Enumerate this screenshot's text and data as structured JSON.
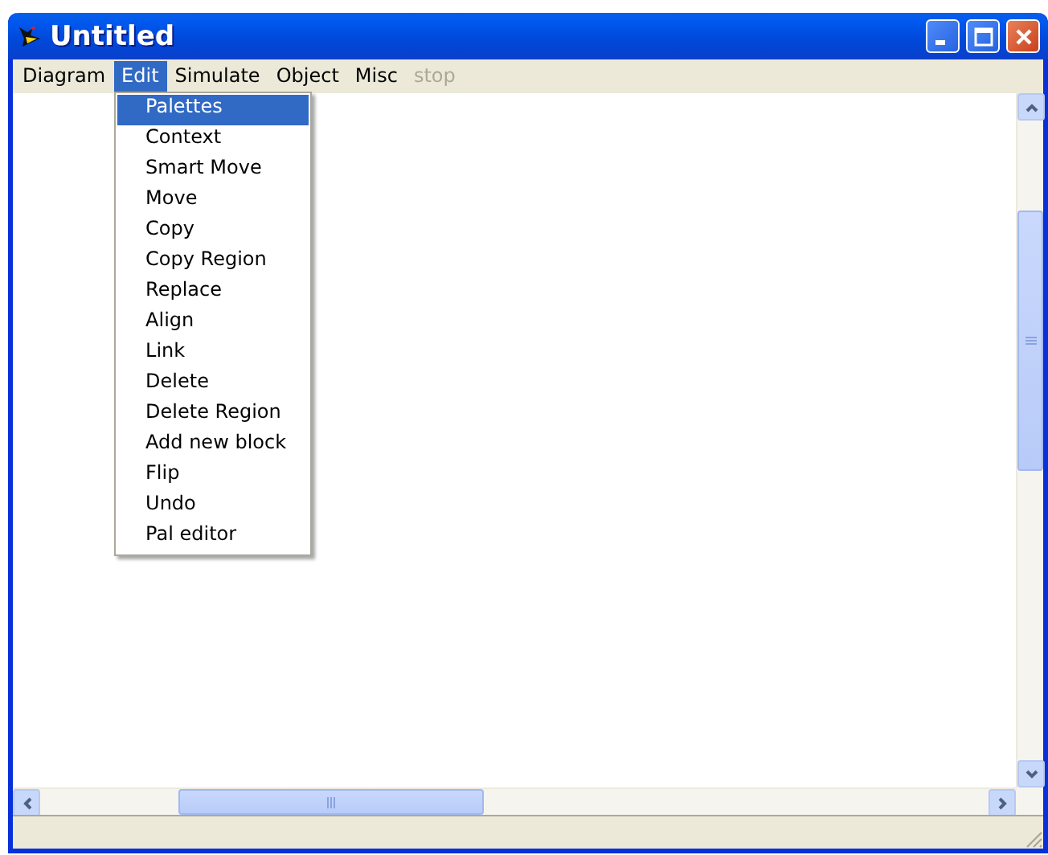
{
  "window": {
    "title": "Untitled"
  },
  "menu_bar": [
    {
      "label": "Diagram",
      "selected": false,
      "disabled": false
    },
    {
      "label": "Edit",
      "selected": true,
      "disabled": false
    },
    {
      "label": "Simulate",
      "selected": false,
      "disabled": false
    },
    {
      "label": "Object",
      "selected": false,
      "disabled": false
    },
    {
      "label": "Misc",
      "selected": false,
      "disabled": false
    },
    {
      "label": "stop",
      "selected": false,
      "disabled": true
    }
  ],
  "edit_menu": [
    {
      "label": "Palettes",
      "selected": true
    },
    {
      "label": "Context",
      "selected": false
    },
    {
      "label": "Smart Move",
      "selected": false
    },
    {
      "label": "Move",
      "selected": false
    },
    {
      "label": "Copy",
      "selected": false
    },
    {
      "label": "Copy Region",
      "selected": false
    },
    {
      "label": "Replace",
      "selected": false
    },
    {
      "label": "Align",
      "selected": false
    },
    {
      "label": "Link",
      "selected": false
    },
    {
      "label": "Delete",
      "selected": false
    },
    {
      "label": "Delete Region",
      "selected": false
    },
    {
      "label": "Add new block",
      "selected": false
    },
    {
      "label": "Flip",
      "selected": false
    },
    {
      "label": "Undo",
      "selected": false
    },
    {
      "label": "Pal editor",
      "selected": false
    }
  ]
}
